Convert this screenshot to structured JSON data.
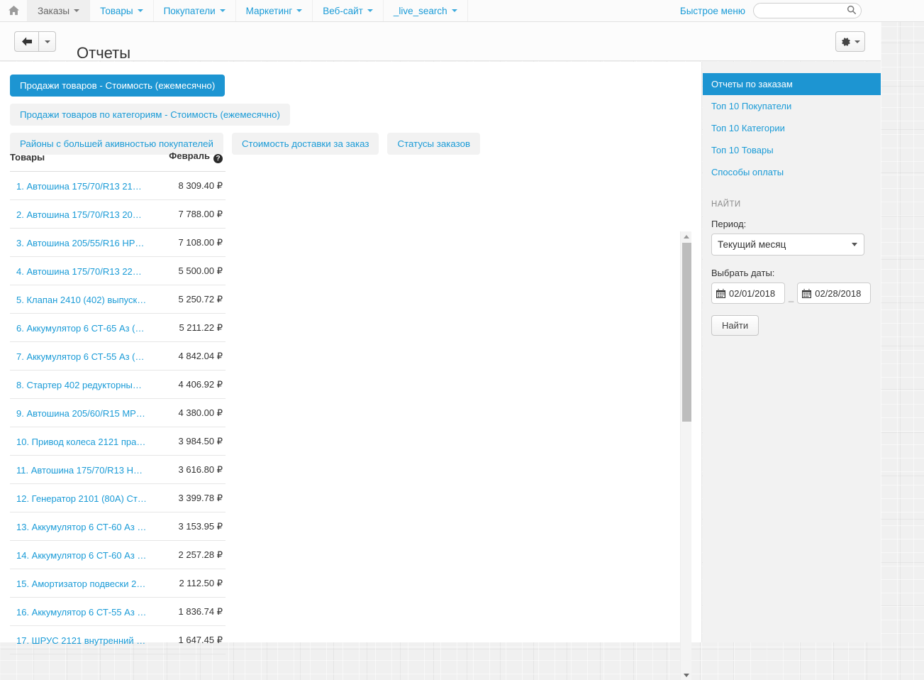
{
  "navbar": {
    "home_icon": "home-icon",
    "items": [
      {
        "label": "Заказы",
        "active": true,
        "caret": true
      },
      {
        "label": "Товары",
        "active": false,
        "caret": true
      },
      {
        "label": "Покупатели",
        "active": false,
        "caret": true
      },
      {
        "label": "Маркетинг",
        "active": false,
        "caret": true
      },
      {
        "label": "Веб-сайт",
        "active": false,
        "caret": true
      },
      {
        "label": "_live_search",
        "active": false,
        "caret": true
      }
    ],
    "quick_menu_label": "Быстрое меню",
    "search_value": "",
    "search_placeholder": "",
    "search_icon": "search-icon"
  },
  "header": {
    "back_icon": "arrow-left-icon",
    "back_dropdown_icon": "caret-down-icon",
    "title": "Отчеты",
    "gear_icon": "gear-icon",
    "gear_caret_icon": "caret-down-icon"
  },
  "report_tabs": [
    {
      "label": "Продажи товаров - Стоимость (ежемесячно)",
      "active": true
    },
    {
      "label": "Продажи товаров по категориям - Стоимость (ежемесячно)",
      "active": false
    },
    {
      "label": "Районы с большей акивностью покупателей",
      "active": false
    },
    {
      "label": "Стоимость доставки за заказ",
      "active": false
    },
    {
      "label": "Статусы заказов",
      "active": false
    }
  ],
  "table": {
    "columns": [
      "Товары",
      "Февраль"
    ],
    "help_icon": "question-mark-icon",
    "help_glyph": "?",
    "rows": [
      {
        "name": "1. Автошина 175/70/R13 21…",
        "value": "8 309.40 ₽"
      },
      {
        "name": "2. Автошина 175/70/R13 20…",
        "value": "7 788.00 ₽"
      },
      {
        "name": "3. Автошина 205/55/R16 HP…",
        "value": "7 108.00 ₽"
      },
      {
        "name": "4. Автошина 175/70/R13 22…",
        "value": "5 500.00 ₽"
      },
      {
        "name": "5. Клапан 2410 (402) выпуск…",
        "value": "5 250.72 ₽"
      },
      {
        "name": "6. Аккумулятор 6 СТ-65 Аз (…",
        "value": "5 211.22 ₽"
      },
      {
        "name": "7. Аккумулятор 6 СТ-55 Аз (…",
        "value": "4 842.04 ₽"
      },
      {
        "name": "8. Стартер 402 редукторны…",
        "value": "4 406.92 ₽"
      },
      {
        "name": "9. Автошина 205/60/R15 MP…",
        "value": "4 380.00 ₽"
      },
      {
        "name": "10. Привод колеса 2121 пра…",
        "value": "3 984.50 ₽"
      },
      {
        "name": "11. Автошина 175/70/R13 H…",
        "value": "3 616.80 ₽"
      },
      {
        "name": "12. Генератор 2101 (80А) Ст…",
        "value": "3 399.78 ₽"
      },
      {
        "name": "13. Аккумулятор 6 СТ-60 Аз …",
        "value": "3 153.95 ₽"
      },
      {
        "name": "14. Аккумулятор 6 СТ-60 Аз …",
        "value": "2 257.28 ₽"
      },
      {
        "name": "15. Амортизатор подвески 2…",
        "value": "2 112.50 ₽"
      },
      {
        "name": "16. Аккумулятор 6 СТ-55 Аз …",
        "value": "1 836.74 ₽"
      },
      {
        "name": "17. ШРУС 2121 внутренний …",
        "value": "1 647.45 ₽"
      }
    ]
  },
  "sidebar": {
    "links": [
      {
        "label": "Отчеты по заказам",
        "active": true
      },
      {
        "label": "Топ 10 Покупатели",
        "active": false
      },
      {
        "label": "Топ 10 Категории",
        "active": false
      },
      {
        "label": "Топ 10 Товары",
        "active": false
      },
      {
        "label": "Способы оплаты",
        "active": false
      }
    ],
    "filter": {
      "heading": "НАЙТИ",
      "period_label": "Период:",
      "period_value": "Текущий месяц",
      "period_options": [
        "Текущий месяц"
      ],
      "dates_label": "Выбрать даты:",
      "date_from": "02/01/2018",
      "date_to": "02/28/2018",
      "date_separator": "_",
      "calendar_icon": "calendar-icon",
      "find_button": "Найти"
    }
  },
  "colors": {
    "accent": "#1d95d2",
    "link": "#1a9bd7",
    "chip_bg": "#f2f2f2",
    "sidebar_bg": "#f2f2f2"
  }
}
